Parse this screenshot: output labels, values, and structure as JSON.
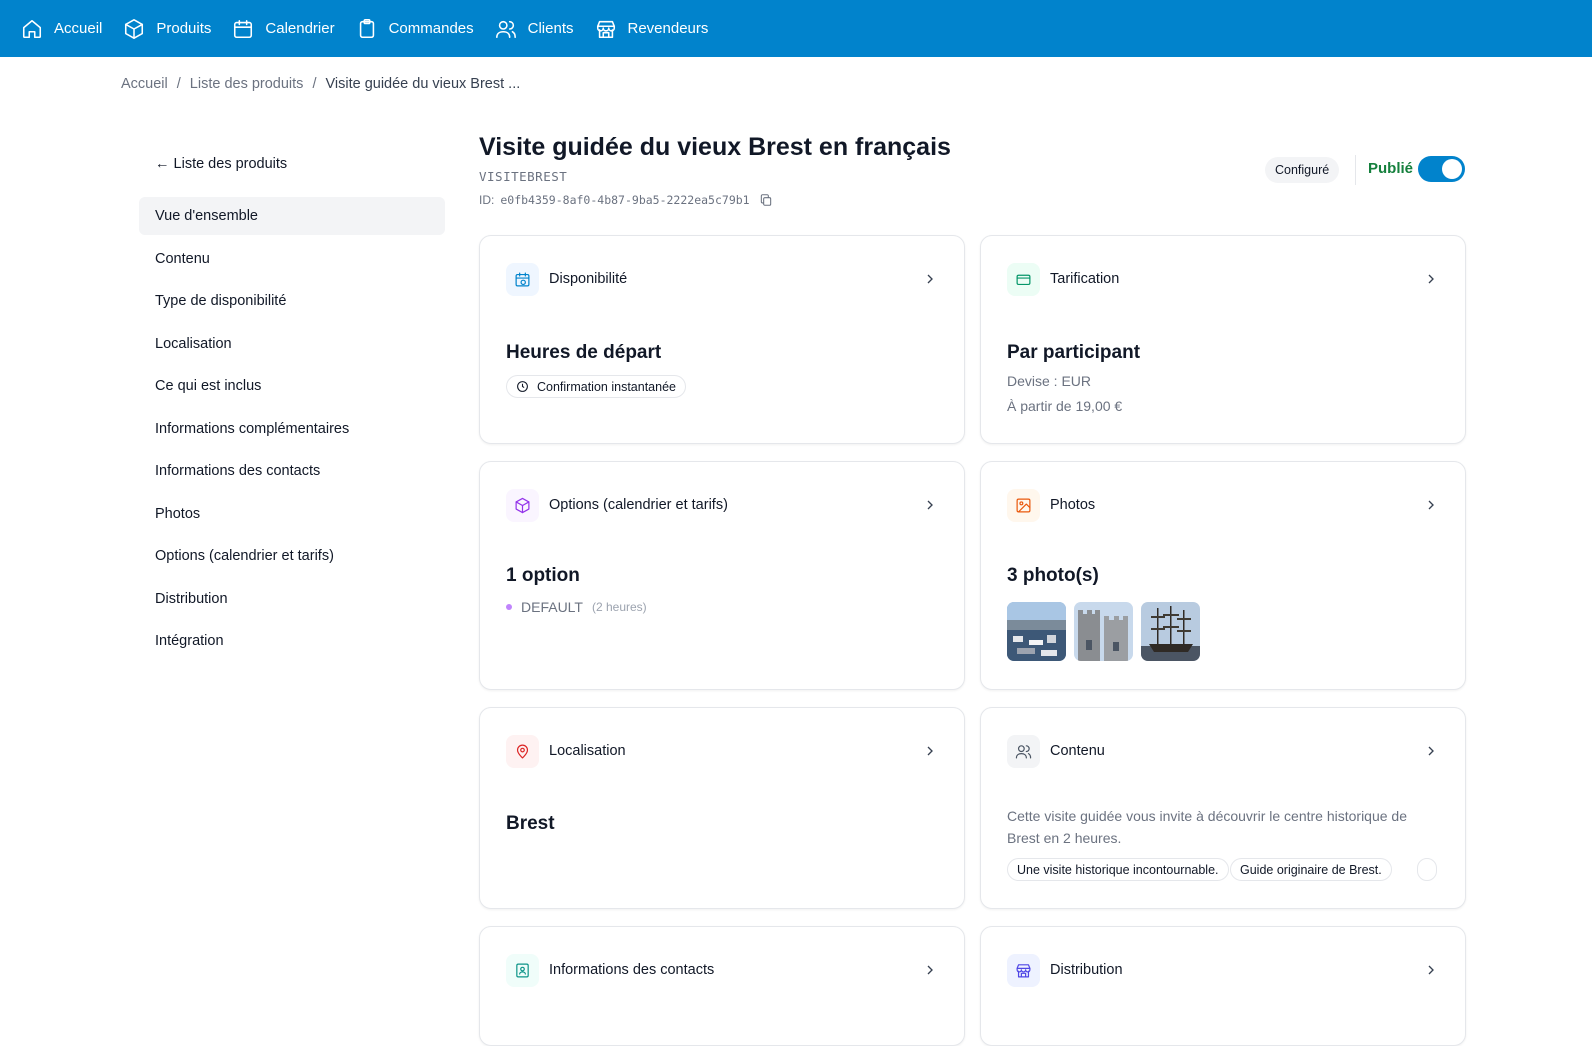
{
  "nav": {
    "items": [
      {
        "label": "Accueil",
        "icon": "home-icon"
      },
      {
        "label": "Produits",
        "icon": "cube-icon"
      },
      {
        "label": "Calendrier",
        "icon": "calendar-icon"
      },
      {
        "label": "Commandes",
        "icon": "clipboard-icon"
      },
      {
        "label": "Clients",
        "icon": "users-icon"
      },
      {
        "label": "Revendeurs",
        "icon": "store-icon"
      }
    ]
  },
  "breadcrumb": {
    "home": "Accueil",
    "list": "Liste des produits",
    "current": "Visite guidée du vieux Brest ..."
  },
  "sidebar": {
    "back": "← Liste des produits",
    "items": [
      "Vue d'ensemble",
      "Contenu",
      "Type de disponibilité",
      "Localisation",
      "Ce qui est inclus",
      "Informations complémentaires",
      "Informations des contacts",
      "Photos",
      "Options (calendrier et tarifs)",
      "Distribution",
      "Intégration"
    ]
  },
  "product": {
    "title": "Visite guidée du vieux Brest en français",
    "code": "VISITEBREST",
    "id_label": "ID:",
    "id": "e0fb4359-8af0-4b87-9ba5-2222ea5c79b1",
    "status_badge": "Configuré",
    "published_label": "Publié",
    "published": true
  },
  "cards": {
    "availability": {
      "title": "Disponibilité",
      "headline": "Heures de départ",
      "pill": "Confirmation instantanée"
    },
    "pricing": {
      "title": "Tarification",
      "headline": "Par participant",
      "currency": "Devise : EUR",
      "from": "À partir de 19,00 €"
    },
    "options": {
      "title": "Options (calendrier et tarifs)",
      "headline": "1 option",
      "option_name": "DEFAULT",
      "option_duration": "(2 heures)"
    },
    "photos": {
      "title": "Photos",
      "headline": "3 photo(s)"
    },
    "location": {
      "title": "Localisation",
      "headline": "Brest"
    },
    "content": {
      "title": "Contenu",
      "description": "Cette visite guidée vous invite à découvrir le centre historique de Brest en 2 heures.",
      "tags": [
        "Une visite historique incontournable.",
        "Guide originaire de Brest."
      ]
    },
    "contacts": {
      "title": "Informations des contacts"
    },
    "distribution": {
      "title": "Distribution"
    }
  },
  "colors": {
    "nav": "#0183cc",
    "published": "#15803d",
    "toggle": "#0183cc"
  }
}
